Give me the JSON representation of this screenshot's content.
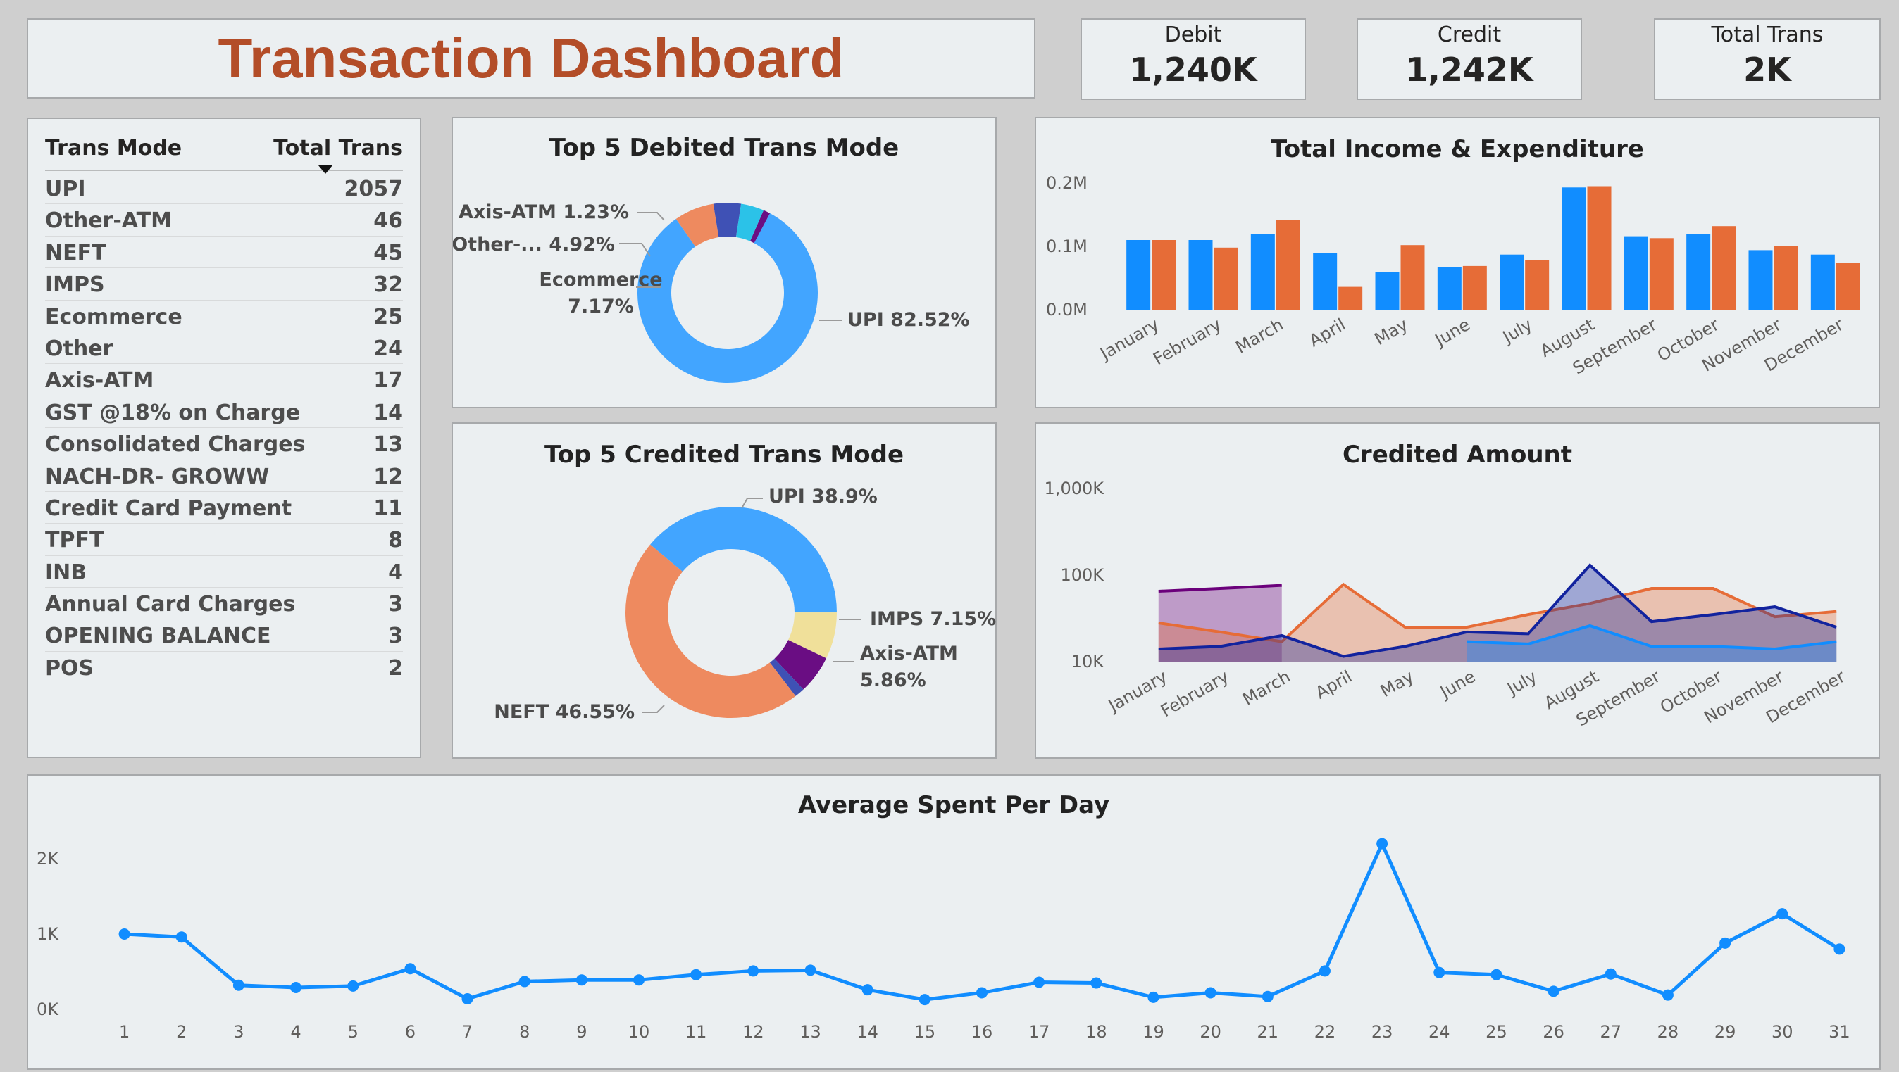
{
  "header": {
    "title": "Transaction Dashboard"
  },
  "kpis": [
    {
      "label": "Debit",
      "value": "1,240K"
    },
    {
      "label": "Credit",
      "value": "1,242K"
    },
    {
      "label": "Total Trans",
      "value": "2K"
    }
  ],
  "table": {
    "col1": "Trans Mode",
    "col2": "Total Trans",
    "rows": [
      {
        "mode": "UPI",
        "count": "2057"
      },
      {
        "mode": "Other-ATM",
        "count": "46"
      },
      {
        "mode": "NEFT",
        "count": "45"
      },
      {
        "mode": "IMPS",
        "count": "32"
      },
      {
        "mode": "Ecommerce",
        "count": "25"
      },
      {
        "mode": "Other",
        "count": "24"
      },
      {
        "mode": "Axis-ATM",
        "count": "17"
      },
      {
        "mode": "GST @18% on Charge",
        "count": "14"
      },
      {
        "mode": "Consolidated Charges",
        "count": "13"
      },
      {
        "mode": "NACH-DR- GROWW",
        "count": "12"
      },
      {
        "mode": "Credit Card Payment",
        "count": "11"
      },
      {
        "mode": "TPFT",
        "count": "8"
      },
      {
        "mode": "INB",
        "count": "4"
      },
      {
        "mode": "Annual Card Charges",
        "count": "3"
      },
      {
        "mode": "OPENING BALANCE",
        "count": "3"
      },
      {
        "mode": "POS",
        "count": "2"
      }
    ]
  },
  "chart_data": [
    {
      "id": "debited",
      "type": "pie",
      "title": "Top 5 Debited Trans Mode",
      "slices": [
        {
          "label": "UPI 82.52%",
          "value": 82.52,
          "color": "#42a5ff"
        },
        {
          "label": "Ecommerce 7.17%",
          "value": 7.17,
          "color": "#ee8a5f"
        },
        {
          "label": "Other-... 4.92%",
          "value": 4.92,
          "color": "#3f51b5"
        },
        {
          "label": "",
          "value": 4.16,
          "color": "#2bc2e8"
        },
        {
          "label": "Axis-ATM 1.23%",
          "value": 1.23,
          "color": "#6a0d83"
        }
      ]
    },
    {
      "id": "credited",
      "type": "pie",
      "title": "Top 5 Credited Trans Mode",
      "slices": [
        {
          "label": "UPI 38.9%",
          "value": 38.9,
          "color": "#42a5ff"
        },
        {
          "label": "IMPS 7.15%",
          "value": 7.15,
          "color": "#f0e09a"
        },
        {
          "label": "Axis-ATM 5.86%",
          "value": 5.86,
          "color": "#6a0d83"
        },
        {
          "label": "",
          "value": 1.54,
          "color": "#3f51b5"
        },
        {
          "label": "NEFT 46.55%",
          "value": 46.55,
          "color": "#ee8a5f"
        }
      ]
    },
    {
      "id": "income",
      "type": "bar",
      "title": "Total Income & Expenditure",
      "categories": [
        "January",
        "February",
        "March",
        "April",
        "May",
        "June",
        "July",
        "August",
        "September",
        "October",
        "November",
        "December"
      ],
      "yticks": [
        "0.0M",
        "0.1M",
        "0.2M"
      ],
      "ylim": [
        0,
        0.2
      ],
      "series": [
        {
          "color": "#118dff",
          "values": [
            0.11,
            0.11,
            0.12,
            0.09,
            0.06,
            0.067,
            0.087,
            0.193,
            0.116,
            0.12,
            0.094,
            0.087
          ]
        },
        {
          "color": "#e66c37",
          "values": [
            0.11,
            0.098,
            0.142,
            0.036,
            0.102,
            0.069,
            0.078,
            0.195,
            0.113,
            0.132,
            0.1,
            0.074
          ]
        }
      ]
    },
    {
      "id": "credited_amount",
      "type": "area",
      "title": "Credited Amount",
      "categories": [
        "January",
        "February",
        "March",
        "April",
        "May",
        "June",
        "July",
        "August",
        "September",
        "October",
        "November",
        "December"
      ],
      "yticks": [
        "10K",
        "100K",
        "1,000K"
      ],
      "scale": "log",
      "ylim": [
        10000,
        1000000
      ],
      "series": [
        {
          "color": "#6b007b",
          "values": [
            65000,
            70000,
            76000,
            null,
            null,
            null,
            null,
            null,
            null,
            null,
            null,
            null
          ]
        },
        {
          "color": "#e66c37",
          "values": [
            28000,
            22000,
            17000,
            78000,
            25000,
            25000,
            35000,
            47000,
            70000,
            70000,
            33000,
            38000
          ]
        },
        {
          "color": "#12239e",
          "values": [
            14000,
            15000,
            20000,
            11500,
            15000,
            22000,
            21000,
            130000,
            29000,
            35000,
            43000,
            25000
          ]
        },
        {
          "color": "#118dff",
          "values": [
            null,
            null,
            null,
            null,
            null,
            17000,
            16000,
            26000,
            15000,
            15000,
            14000,
            17000
          ]
        }
      ]
    },
    {
      "id": "avg_spent",
      "type": "line",
      "title": "Average Spent Per Day",
      "x": [
        1,
        2,
        3,
        4,
        5,
        6,
        7,
        8,
        9,
        10,
        11,
        12,
        13,
        14,
        15,
        16,
        17,
        18,
        19,
        20,
        21,
        22,
        23,
        24,
        25,
        26,
        27,
        28,
        29,
        30,
        31
      ],
      "yticks": [
        "0K",
        "1K",
        "2K"
      ],
      "ylim": [
        0,
        2000
      ],
      "color": "#118dff",
      "values": [
        1000,
        960,
        320,
        290,
        310,
        540,
        140,
        370,
        390,
        390,
        460,
        510,
        520,
        260,
        130,
        220,
        360,
        350,
        160,
        220,
        170,
        510,
        2200,
        490,
        460,
        240,
        470,
        190,
        880,
        1270,
        800
      ]
    }
  ]
}
